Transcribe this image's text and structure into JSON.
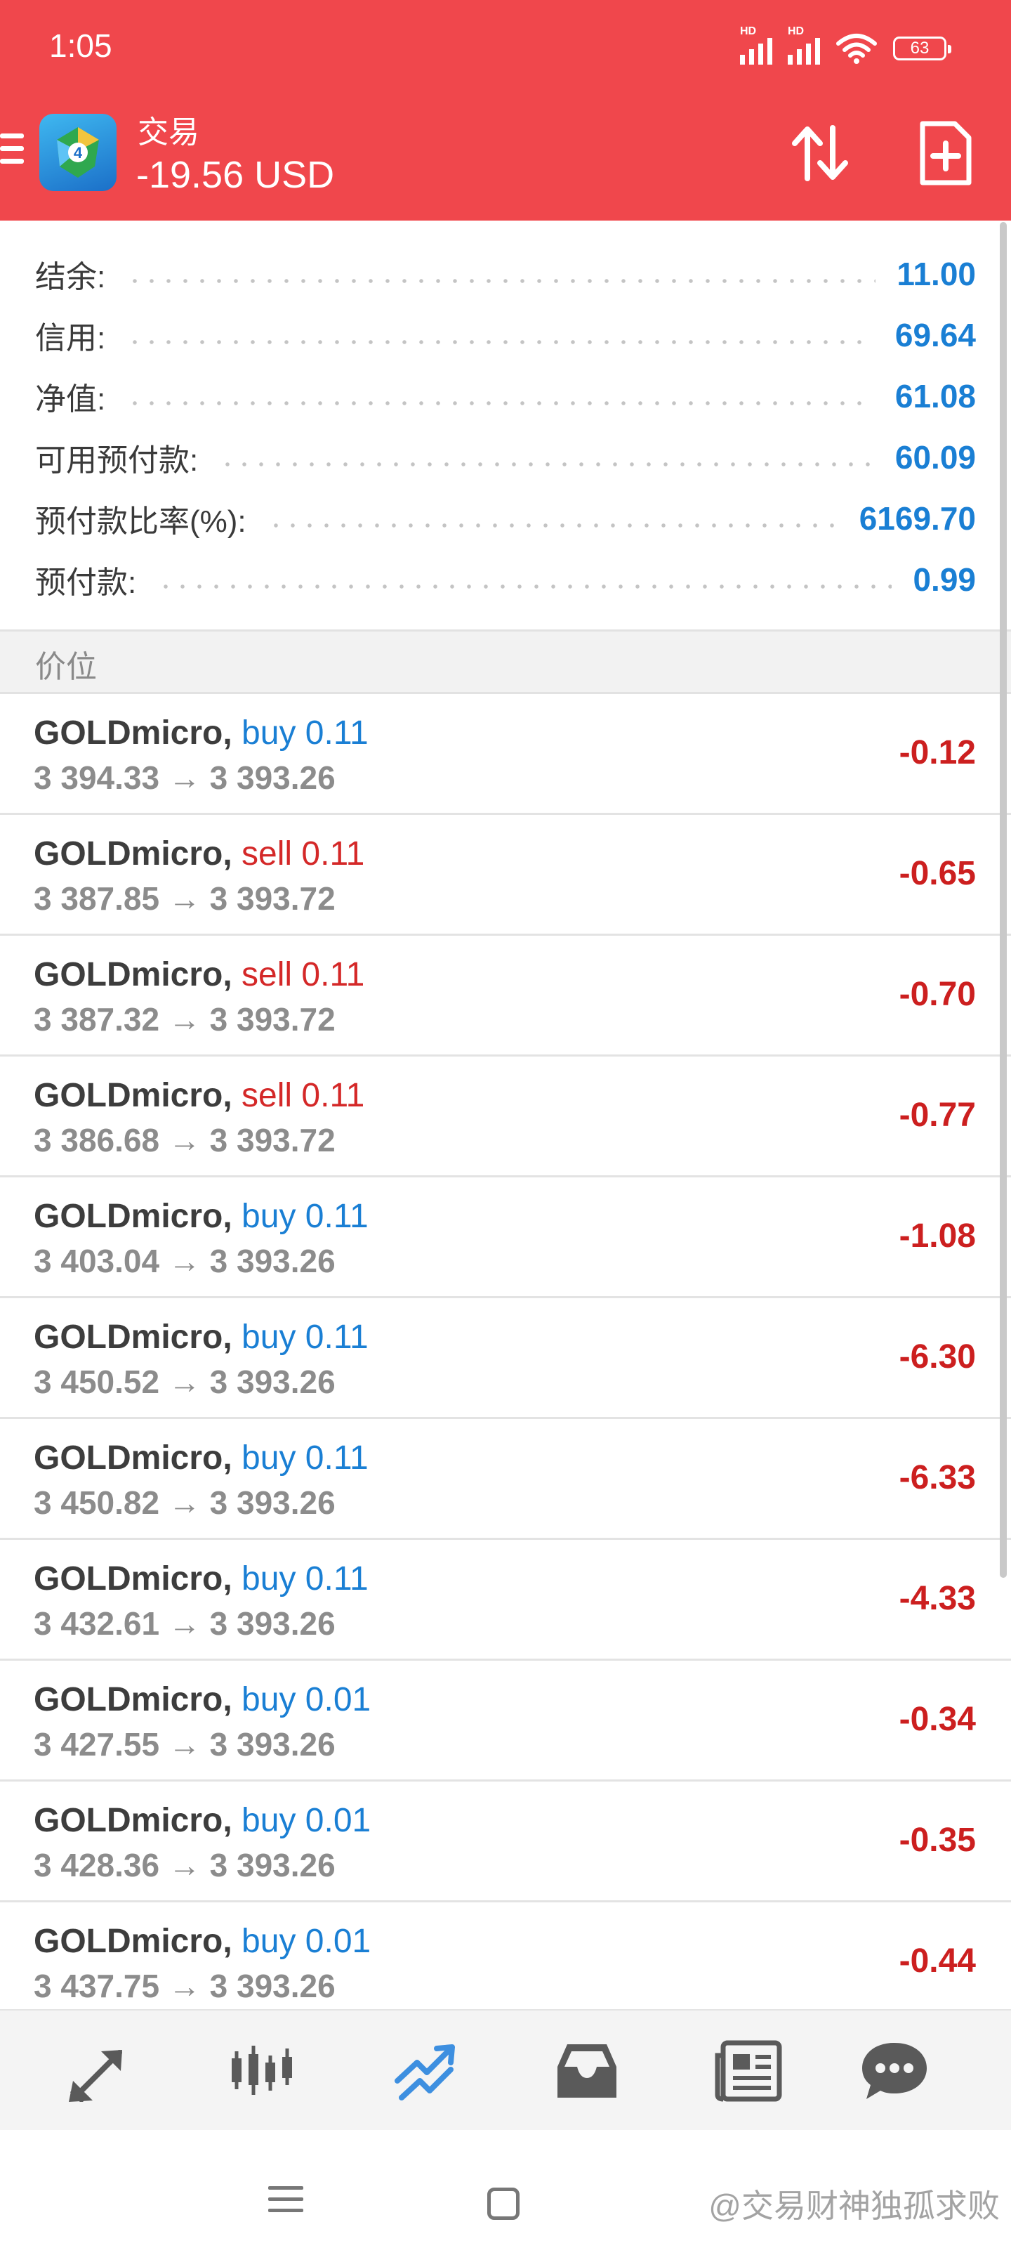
{
  "status_bar": {
    "time": "1:05",
    "signal_label": "HD",
    "battery_level": "63"
  },
  "header": {
    "title": "交易",
    "balance": "-19.56 USD",
    "background_color": "#f0474c",
    "icons": [
      "menu-icon",
      "app-logo",
      "sort-icon",
      "new-order-icon"
    ]
  },
  "summary": [
    {
      "label": "结余:",
      "value": "11.00"
    },
    {
      "label": "信用:",
      "value": "69.64"
    },
    {
      "label": "净值:",
      "value": "61.08"
    },
    {
      "label": "可用预付款:",
      "value": "60.09"
    },
    {
      "label": "预付款比率(%):",
      "value": "6169.70"
    },
    {
      "label": "预付款:",
      "value": "0.99"
    }
  ],
  "section_title": "价位",
  "positions": [
    {
      "symbol": "GOLDmicro",
      "side": "buy",
      "volume": "0.11",
      "open": "3 394.33",
      "arrow": "→",
      "current": "3 393.26",
      "profit": "-0.12"
    },
    {
      "symbol": "GOLDmicro",
      "side": "sell",
      "volume": "0.11",
      "open": "3 387.85",
      "arrow": "→",
      "current": "3 393.72",
      "profit": "-0.65"
    },
    {
      "symbol": "GOLDmicro",
      "side": "sell",
      "volume": "0.11",
      "open": "3 387.32",
      "arrow": "→",
      "current": "3 393.72",
      "profit": "-0.70"
    },
    {
      "symbol": "GOLDmicro",
      "side": "sell",
      "volume": "0.11",
      "open": "3 386.68",
      "arrow": "→",
      "current": "3 393.72",
      "profit": "-0.77"
    },
    {
      "symbol": "GOLDmicro",
      "side": "buy",
      "volume": "0.11",
      "open": "3 403.04",
      "arrow": "→",
      "current": "3 393.26",
      "profit": "-1.08"
    },
    {
      "symbol": "GOLDmicro",
      "side": "buy",
      "volume": "0.11",
      "open": "3 450.52",
      "arrow": "→",
      "current": "3 393.26",
      "profit": "-6.30"
    },
    {
      "symbol": "GOLDmicro",
      "side": "buy",
      "volume": "0.11",
      "open": "3 450.82",
      "arrow": "→",
      "current": "3 393.26",
      "profit": "-6.33"
    },
    {
      "symbol": "GOLDmicro",
      "side": "buy",
      "volume": "0.11",
      "open": "3 432.61",
      "arrow": "→",
      "current": "3 393.26",
      "profit": "-4.33"
    },
    {
      "symbol": "GOLDmicro",
      "side": "buy",
      "volume": "0.01",
      "open": "3 427.55",
      "arrow": "→",
      "current": "3 393.26",
      "profit": "-0.34"
    },
    {
      "symbol": "GOLDmicro",
      "side": "buy",
      "volume": "0.01",
      "open": "3 428.36",
      "arrow": "→",
      "current": "3 393.26",
      "profit": "-0.35"
    },
    {
      "symbol": "GOLDmicro",
      "side": "buy",
      "volume": "0.01",
      "open": "3 437.75",
      "arrow": "→",
      "current": "3 393.26",
      "profit": "-0.44"
    }
  ],
  "colors": {
    "buy": "#1a7fd4",
    "sell": "#d42828",
    "loss": "#cc1f1f",
    "active_nav": "#3d8fe0"
  },
  "bottom_nav": [
    {
      "name": "quotes-icon",
      "active": false
    },
    {
      "name": "chart-icon",
      "active": false
    },
    {
      "name": "trade-icon",
      "active": true
    },
    {
      "name": "history-icon",
      "active": false
    },
    {
      "name": "news-icon",
      "active": false
    },
    {
      "name": "messages-icon",
      "active": false
    }
  ],
  "watermark": "@交易财神独孤求败"
}
